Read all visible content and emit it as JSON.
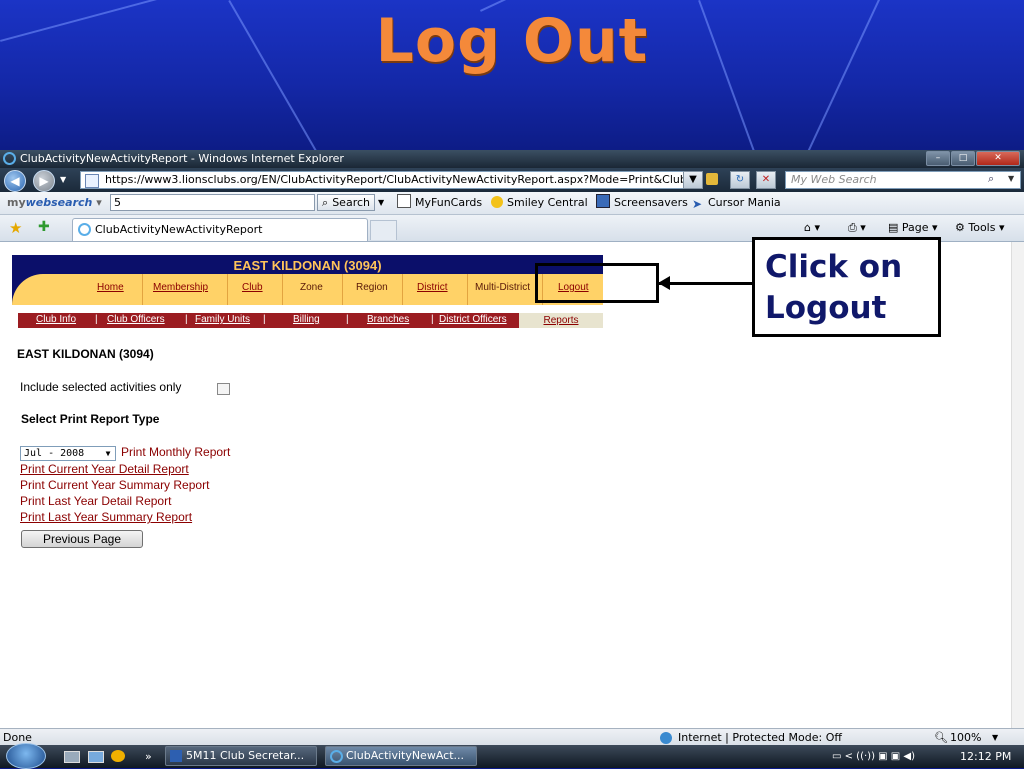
{
  "slide": {
    "title": "Log Out"
  },
  "window": {
    "title": "ClubActivityNewActivityReport - Windows Internet Explorer",
    "address": "https://www3.lionsclubs.org/EN/ClubActivityReport/ClubActivityNewActivityReport.aspx?Mode=Print&Club",
    "web_search_placeholder": "My Web Search",
    "controls": {
      "minimize": "–",
      "maximize": "□",
      "close": "✕"
    }
  },
  "toolbar": {
    "mywebsearch_prefix": "my",
    "mywebsearch_brand": "websearch",
    "search_value": "5",
    "search_button": "Search",
    "links": [
      "MyFunCards",
      "Smiley Central",
      "Screensavers",
      "Cursor Mania"
    ]
  },
  "tabs": {
    "active": "ClubActivityNewActivityReport"
  },
  "commands": {
    "page": "Page",
    "tools": "Tools"
  },
  "site": {
    "club_title": "EAST KILDONAN (3094)",
    "nav": [
      "Home",
      "Membership",
      "Club",
      "Zone",
      "Region",
      "District",
      "Multi-District",
      "Logout"
    ],
    "subnav": [
      "Club Info",
      "Club Officers",
      "Family Units",
      "Billing",
      "Branches",
      "District Officers"
    ],
    "subnav_active": "Reports"
  },
  "content": {
    "heading": "EAST KILDONAN (3094)",
    "include_label": "Include selected activities only",
    "select_type_label": "Select Print Report Type",
    "month_value": "Jul - 2008",
    "print_monthly": "Print Monthly Report",
    "links": [
      "Print Current Year Detail Report",
      "Print Current Year Summary Report",
      "Print Last Year Detail Report",
      "Print Last Year Summary Report"
    ],
    "previous_button": "Previous Page"
  },
  "callout": {
    "line1": "Click on",
    "line2": "Logout"
  },
  "status": {
    "left": "Done",
    "zone": "Internet | Protected Mode: Off",
    "zoom": "100%"
  },
  "taskbar": {
    "tasks": [
      "5M11 Club Secretar...",
      "ClubActivityNewAct..."
    ],
    "clock": "12:12 PM"
  },
  "colors": {
    "slide_title": "#f4893a",
    "nav_bg": "#ffd267",
    "header_bg": "#0b0f6a",
    "subnav_bg": "#9b1c21",
    "link": "#8b0000"
  }
}
